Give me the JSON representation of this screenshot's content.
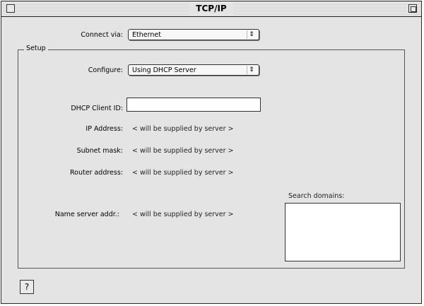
{
  "window": {
    "title": "TCP/IP"
  },
  "connect": {
    "label": "Connect via:",
    "value": "Ethernet"
  },
  "setup": {
    "group_label": "Setup",
    "configure_label": "Configure:",
    "configure_value": "Using DHCP Server",
    "dhcp_label": "DHCP Client ID:",
    "dhcp_value": "",
    "ip_label": "IP Address:",
    "ip_value": "< will be supplied by server >",
    "subnet_label": "Subnet mask:",
    "subnet_value": "< will be supplied by server >",
    "router_label": "Router address:",
    "router_value": "< will be supplied by server >",
    "nameserver_label": "Name server addr.:",
    "nameserver_value": "< will be supplied by server >",
    "search_label": "Search domains:",
    "search_value": ""
  },
  "icons": {
    "popup_arrow": "⇕",
    "help": "?"
  }
}
